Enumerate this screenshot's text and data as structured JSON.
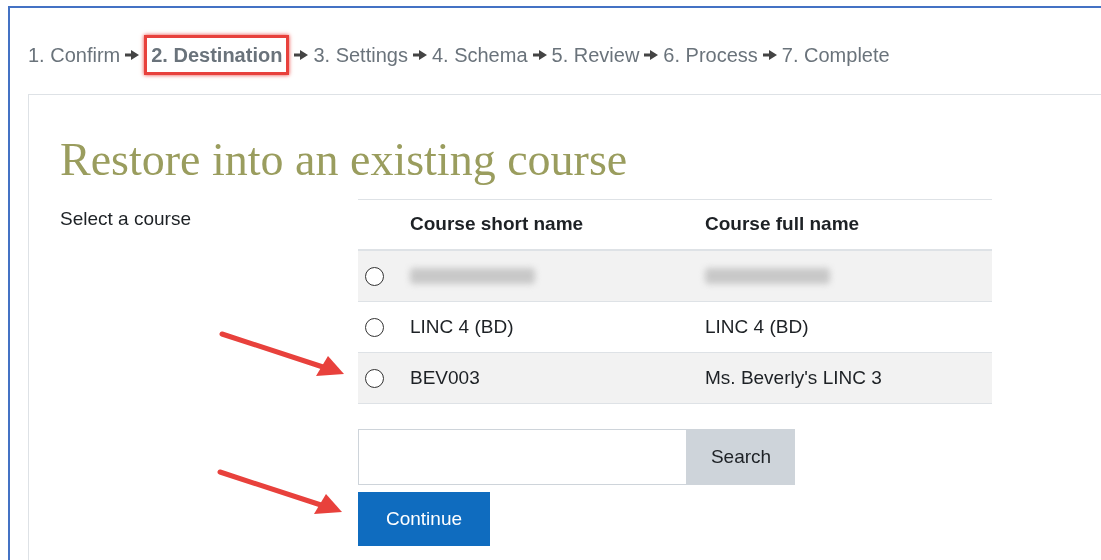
{
  "steps": [
    {
      "label": "1. Confirm",
      "current": false,
      "highlighted": false
    },
    {
      "label": "2. Destination",
      "current": true,
      "highlighted": true
    },
    {
      "label": "3. Settings",
      "current": false,
      "highlighted": false
    },
    {
      "label": "4. Schema",
      "current": false,
      "highlighted": false
    },
    {
      "label": "5. Review",
      "current": false,
      "highlighted": false
    },
    {
      "label": "6. Process",
      "current": false,
      "highlighted": false
    },
    {
      "label": "7. Complete",
      "current": false,
      "highlighted": false
    }
  ],
  "heading": "Restore into an existing course",
  "field_label": "Select a course",
  "table": {
    "columns": [
      "Course short name",
      "Course full name"
    ],
    "rows": [
      {
        "kind": "blurred",
        "selected": false
      },
      {
        "kind": "text",
        "short_name": "LINC 4 (BD)",
        "full_name": "LINC 4 (BD)",
        "selected": false
      },
      {
        "kind": "text",
        "short_name": "BEV003",
        "full_name": "Ms. Beverly's LINC 3",
        "selected": false
      }
    ]
  },
  "search": {
    "button": "Search"
  },
  "continue_button": "Continue"
}
